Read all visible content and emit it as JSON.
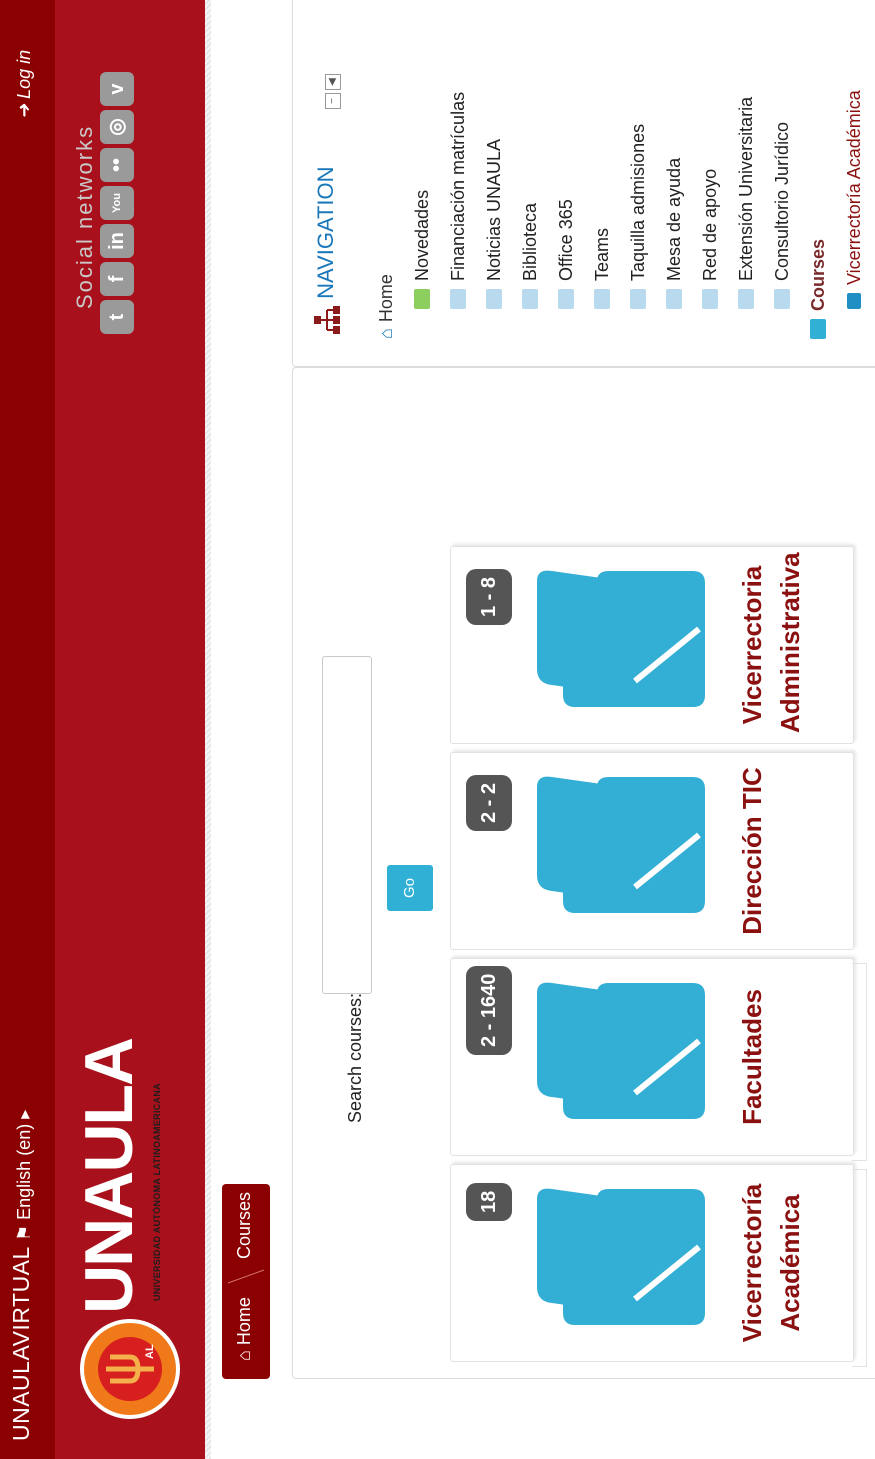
{
  "topbar": {
    "site_name": "UNAULAVIRTUAL",
    "language": "English (en)",
    "login": "Log in"
  },
  "header": {
    "logo_text": "UNAULA",
    "logo_subtitle": "UNIVERSIDAD AUTÓNOMA LATINOAMERICANA",
    "logo_badge": "AL",
    "social_label": "Social networks",
    "social_icons": [
      "twitter-icon",
      "facebook-icon",
      "linkedin-icon",
      "youtube-icon",
      "flickr-icon",
      "instagram-icon",
      "vimeo-icon"
    ]
  },
  "breadcrumb": {
    "home": "Home",
    "courses": "Courses"
  },
  "search": {
    "label": "Search courses:",
    "value": "",
    "button": "Go"
  },
  "categories": [
    {
      "name": "Vicerrectoría Académica",
      "count": "18"
    },
    {
      "name": "Facultades",
      "count": "2 - 1640"
    },
    {
      "name": "Dirección TIC",
      "count": "2 - 2"
    },
    {
      "name": "Vicerrectoria Administrativa",
      "count": "1 - 8"
    }
  ],
  "navigation": {
    "title": "NAVIGATION",
    "home": "Home",
    "items": [
      "Novedades",
      "Financiación matrículas",
      "Noticias UNAULA",
      "Biblioteca",
      "Office 365",
      "Teams",
      "Taquilla admisiones",
      "Mesa de ayuda",
      "Red de apoyo",
      "Extensión Universitaria",
      "Consultorio Jurídico"
    ],
    "courses": "Courses",
    "sub_item": "Vicerrectoría Académica"
  },
  "colors": {
    "brand_red": "#8b0000",
    "header_red": "#a8111c",
    "accent_blue": "#2fb0d4",
    "title_red": "#8b1010",
    "badge_gray": "#555555"
  }
}
